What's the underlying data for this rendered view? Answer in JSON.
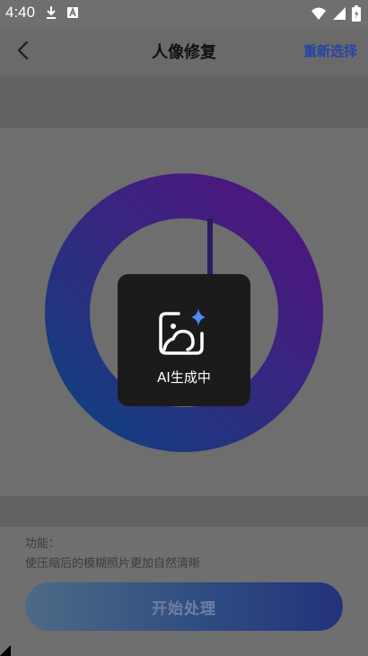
{
  "status": {
    "time": "4:40"
  },
  "header": {
    "title": "人像修复",
    "reselect": "重新选择"
  },
  "toast": {
    "text": "AI生成中"
  },
  "feature": {
    "title": "功能：",
    "description": "使压缩后的模糊照片更加自然清晰"
  },
  "actions": {
    "start_label": "开始处理"
  },
  "colors": {
    "accent": "#2444a8",
    "ring_start": "#4c177e",
    "ring_end": "#163a82",
    "toast_bg": "#1b1b1b"
  },
  "icons": {
    "back": "chevron-left-icon",
    "download": "download-icon",
    "app": "a-icon",
    "wifi": "wifi-icon",
    "signal": "signal-icon",
    "battery": "battery-icon",
    "ai": "image-sparkle-icon"
  }
}
